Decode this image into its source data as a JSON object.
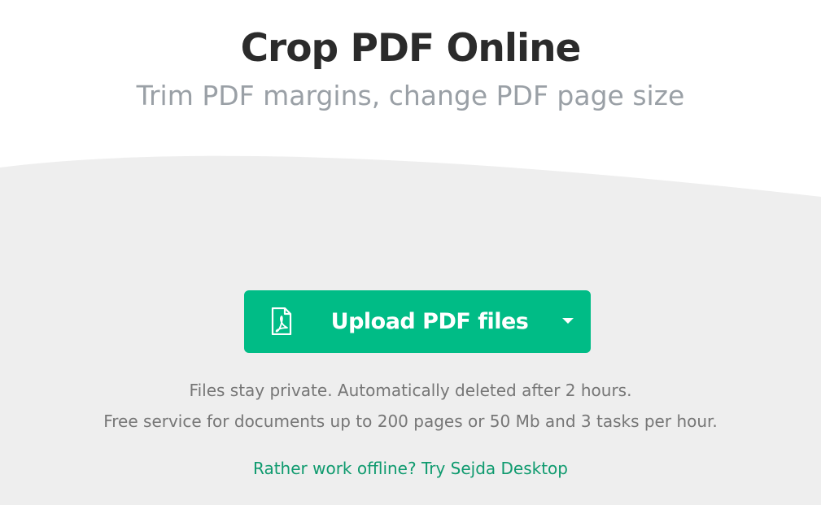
{
  "header": {
    "title": "Crop PDF Online",
    "subtitle": "Trim PDF margins, change PDF page size"
  },
  "upload": {
    "label": "Upload PDF files",
    "icon": "pdf-file-icon",
    "dropdown_icon": "caret-down-icon"
  },
  "notes": {
    "privacy": "Files stay private. Automatically deleted after 2 hours.",
    "limits": "Free service for documents up to 200 pages or 50 Mb and 3 tasks per hour."
  },
  "desktop_link": {
    "label": "Rather work offline? Try Sejda Desktop"
  },
  "colors": {
    "accent": "#00bc86",
    "link": "#0e9a6e",
    "title": "#2b2b2b",
    "subtitle": "#9aa0a6",
    "muted_text": "#767676",
    "panel_background": "#eeeeee"
  }
}
